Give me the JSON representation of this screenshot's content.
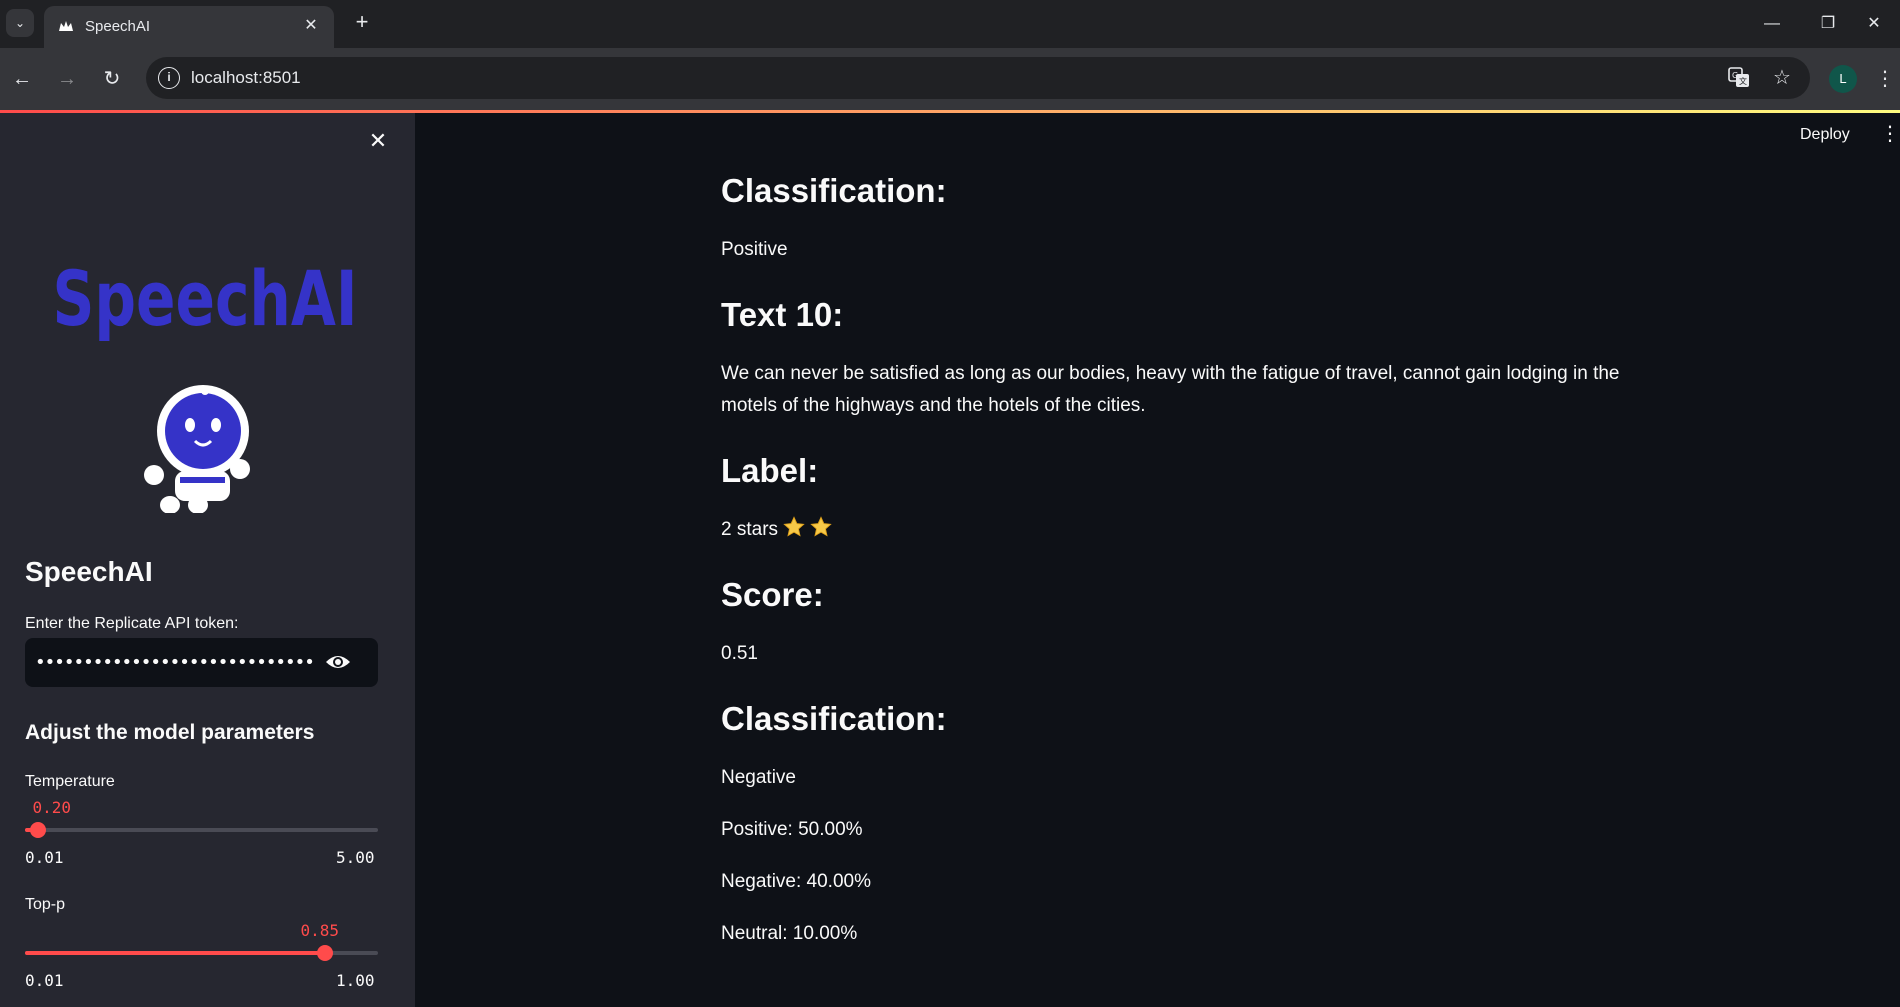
{
  "browser": {
    "tab_title": "SpeechAI",
    "url": "localhost:8501",
    "profile_initial": "L"
  },
  "sidebar": {
    "logo_text": "SpeechAI",
    "title": "SpeechAI",
    "token_label": "Enter the Replicate API token:",
    "token_value": "••••••••••••••••••••••••••••••••••••••••",
    "params_header": "Adjust the model parameters",
    "temperature": {
      "label": "Temperature",
      "value": 0.2,
      "value_text": "0.20",
      "min": "0.01",
      "max": "5.00",
      "min_num": 0.01,
      "max_num": 5.0
    },
    "top_p": {
      "label": "Top-p",
      "value": 0.85,
      "value_text": "0.85",
      "min": "0.01",
      "max": "1.00",
      "min_num": 0.01,
      "max_num": 1.0
    }
  },
  "header": {
    "deploy_label": "Deploy"
  },
  "main": {
    "classification_heading_1": "Classification:",
    "classification_value_1": "Positive",
    "text_heading": "Text 10:",
    "text_body": "We can never be satisfied as long as our bodies, heavy with the fatigue of travel, cannot gain lodging in the motels of the highways and the hotels of the cities.",
    "label_heading": "Label:",
    "label_value": "2 stars",
    "label_stars": 2,
    "score_heading": "Score:",
    "score_value": "0.51",
    "classification_heading_2": "Classification:",
    "classification_value_2": "Negative",
    "positive": "Positive: 50.00%",
    "negative": "Negative: 40.00%",
    "neutral": "Neutral: 10.00%"
  },
  "colors": {
    "accent": "#ff4b4b",
    "background": "#0e1117",
    "sidebar": "#262730",
    "logo": "#3533c8"
  }
}
